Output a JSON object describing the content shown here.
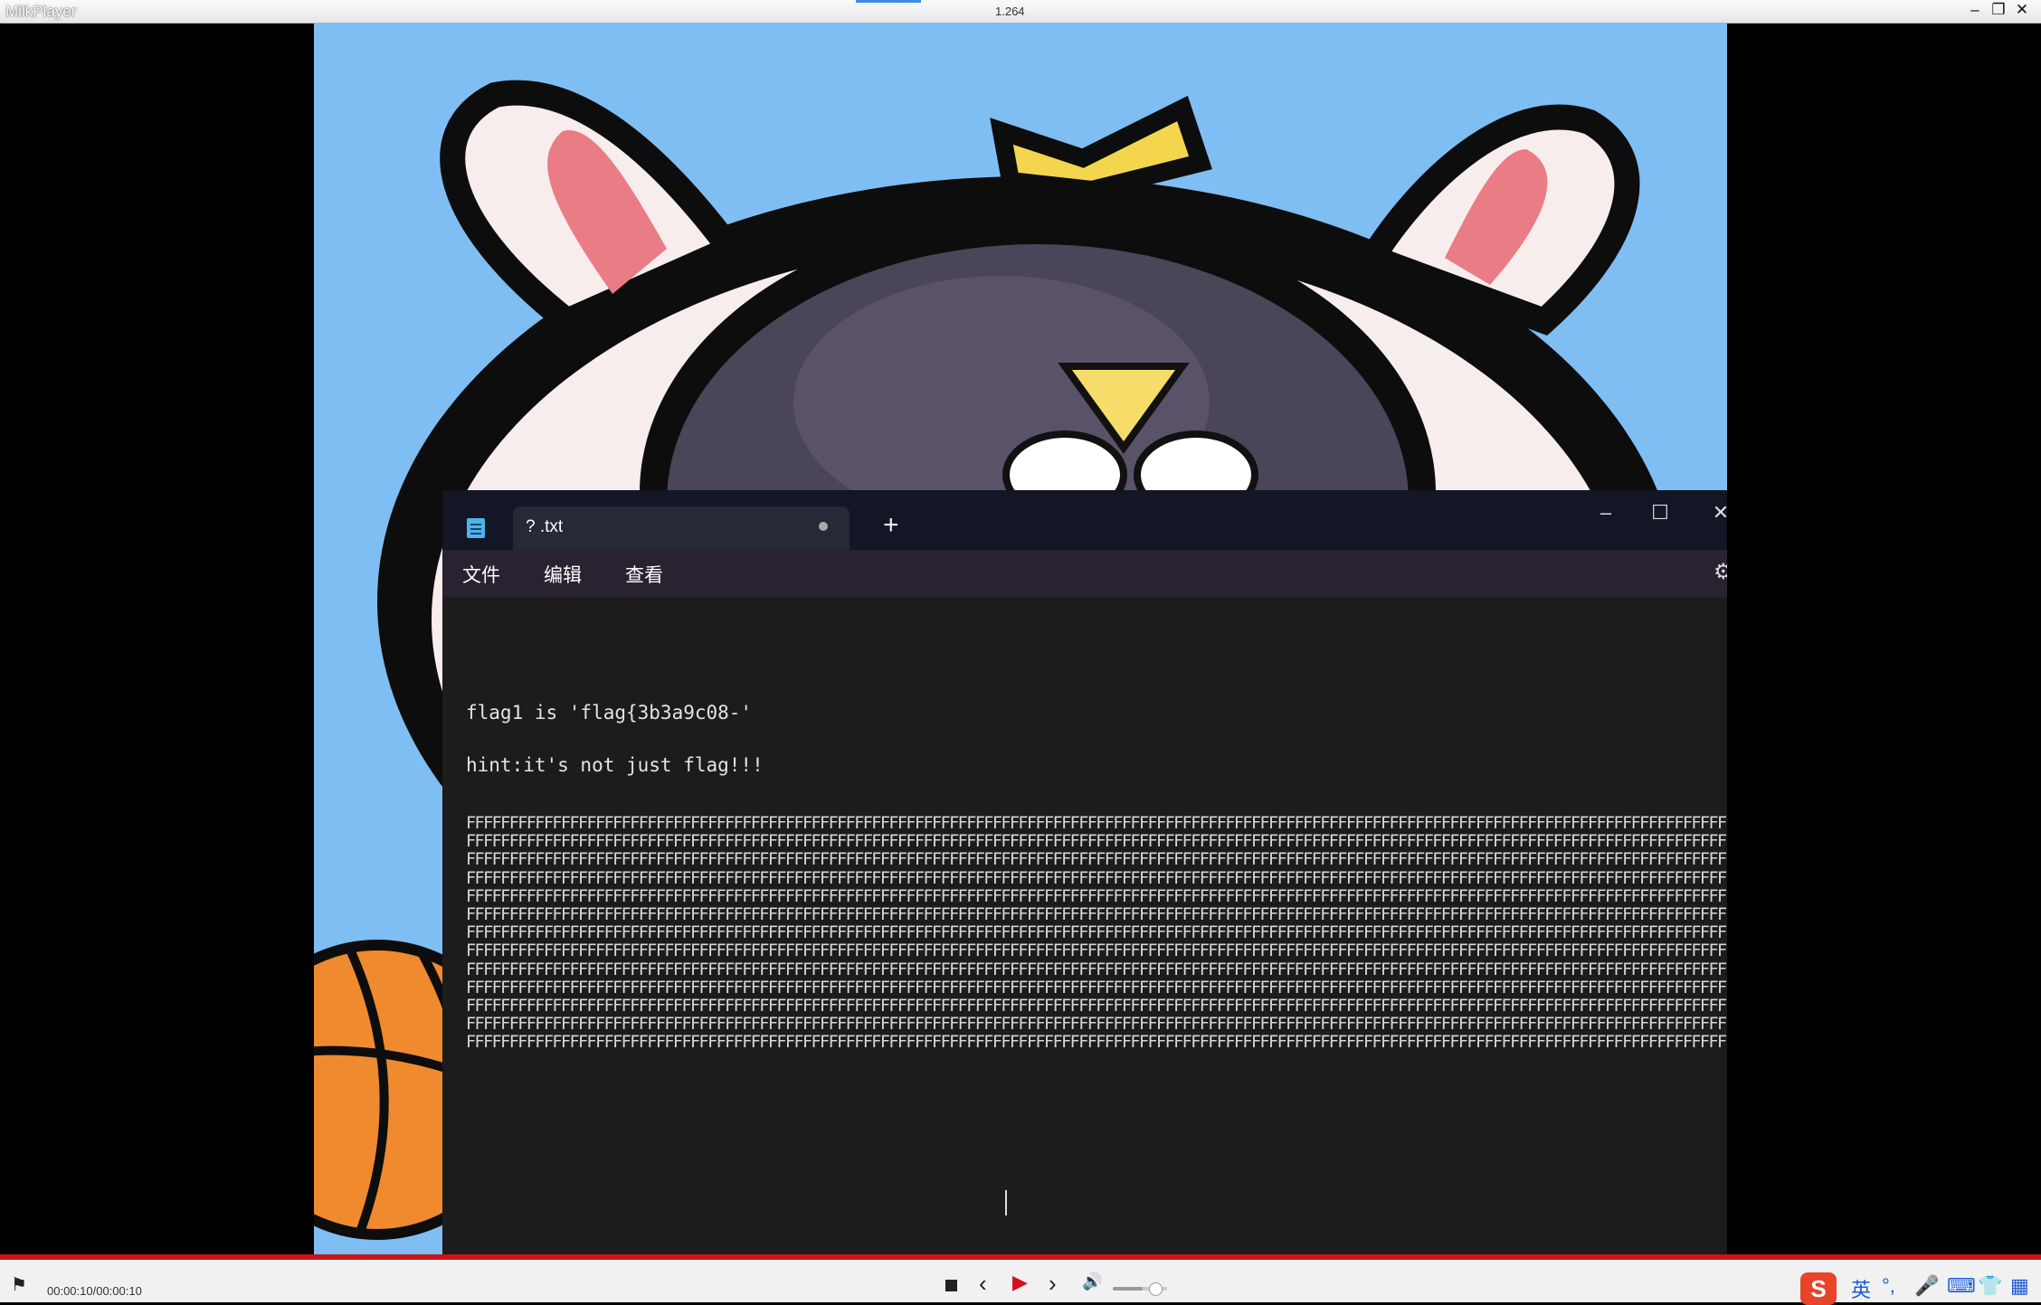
{
  "titlebar": {
    "app_title": "MilkPlayer",
    "center_text": "1.264"
  },
  "notepad": {
    "tab_title": "? .txt",
    "menu": [
      "文件",
      "编辑",
      "查看"
    ],
    "lines": [
      "flag1 is 'flag{3b3a9c08-'",
      "hint:it's not just flag!!!"
    ],
    "f_row": "FFFFFFFFFFFFFFFFFFFFFFFFFFFFFFFFFFFFFFFFFFFFFFFFFFFFFFFFFFFFFFFFFFFFFFFFFFFFFFFFFFFFFFFFFFFFFFFFFFFFFFFFFFFFFFFFFFFFFFFFFFFFFFFFFFFFFFFFFFFFFFFFFFFFFFFFFFFFFFFFFFFFFFFF",
    "f_row_count": 13
  },
  "player": {
    "timecode": "00:00:10/00:00:10",
    "volume": 0.55,
    "progress": 1.0
  },
  "tray": {
    "ime_label": "英"
  },
  "colors": {
    "progress_red": "#c9141a",
    "play_red": "#d0121b",
    "video_sky": "#7fbef2",
    "notepad_bg": "#1c1c1c"
  },
  "icons": [
    "minimize-icon",
    "restore-icon",
    "close-icon",
    "notepad-icon",
    "tab-close-dot-icon",
    "new-tab-icon",
    "settings-icon",
    "flag-icon",
    "stop-icon",
    "prev-icon",
    "play-icon",
    "next-icon",
    "volume-icon",
    "sogou-icon",
    "mic-icon",
    "keyboard-icon",
    "skin-icon",
    "grid-icon"
  ]
}
